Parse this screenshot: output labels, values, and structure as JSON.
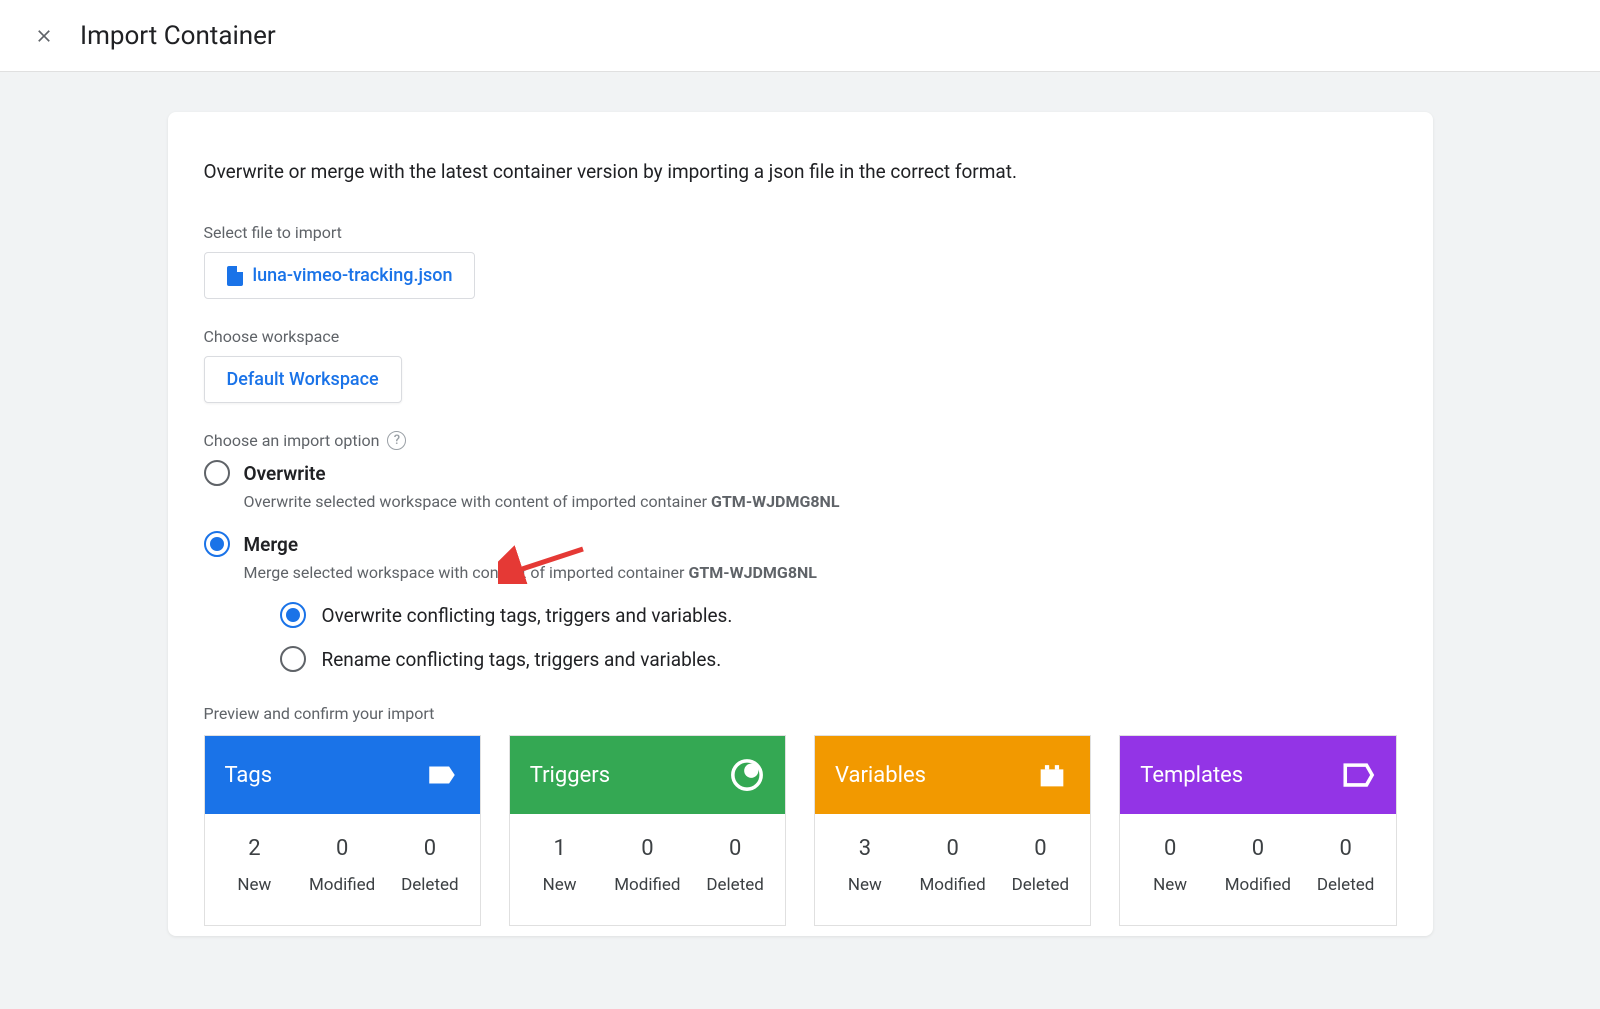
{
  "header": {
    "title": "Import Container"
  },
  "intro": "Overwrite or merge with the latest container version by importing a json file in the correct format.",
  "file_section": {
    "label": "Select file to import",
    "filename": "luna-vimeo-tracking.json"
  },
  "workspace_section": {
    "label": "Choose workspace",
    "workspace": "Default Workspace"
  },
  "import_option": {
    "label": "Choose an import option",
    "overwrite": {
      "title": "Overwrite",
      "desc_prefix": "Overwrite selected workspace with content of imported container ",
      "container_id": "GTM-WJDMG8NL"
    },
    "merge": {
      "title": "Merge",
      "desc_prefix": "Merge selected workspace with content of imported container ",
      "container_id": "GTM-WJDMG8NL",
      "sub_overwrite": "Overwrite conflicting tags, triggers and variables.",
      "sub_rename": "Rename conflicting tags, triggers and variables."
    }
  },
  "preview": {
    "label": "Preview and confirm your import",
    "col_labels": {
      "new": "New",
      "modified": "Modified",
      "deleted": "Deleted"
    },
    "cards": [
      {
        "title": "Tags",
        "new": "2",
        "modified": "0",
        "deleted": "0"
      },
      {
        "title": "Triggers",
        "new": "1",
        "modified": "0",
        "deleted": "0"
      },
      {
        "title": "Variables",
        "new": "3",
        "modified": "0",
        "deleted": "0"
      },
      {
        "title": "Templates",
        "new": "0",
        "modified": "0",
        "deleted": "0"
      }
    ]
  }
}
